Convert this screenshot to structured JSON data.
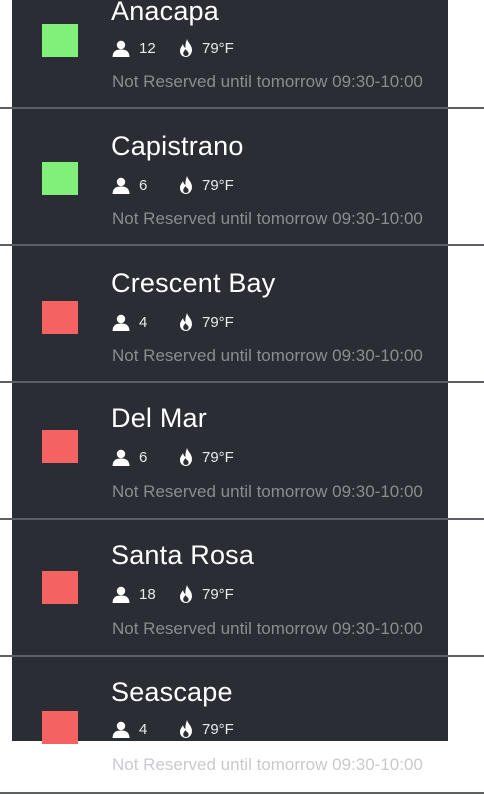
{
  "colors": {
    "panel_bg": "#2a2d34",
    "available": "#80f07a",
    "occupied": "#f46361",
    "divider": "#5c5f66"
  },
  "icons": {
    "capacity": "person-icon",
    "temperature": "flame-icon"
  },
  "rooms": [
    {
      "name": "Anacapa",
      "status": "available",
      "capacity": "12",
      "temperature": "79°F",
      "reservation": "Not Reserved until tomorrow 09:30-10:00"
    },
    {
      "name": "Capistrano",
      "status": "available",
      "capacity": "6",
      "temperature": "79°F",
      "reservation": "Not Reserved until tomorrow 09:30-10:00"
    },
    {
      "name": "Crescent Bay",
      "status": "occupied",
      "capacity": "4",
      "temperature": "79°F",
      "reservation": "Not Reserved until tomorrow 09:30-10:00"
    },
    {
      "name": "Del Mar",
      "status": "occupied",
      "capacity": "6",
      "temperature": "79°F",
      "reservation": "Not Reserved until tomorrow 09:30-10:00"
    },
    {
      "name": "Santa Rosa",
      "status": "occupied",
      "capacity": "18",
      "temperature": "79°F",
      "reservation": "Not Reserved until tomorrow 09:30-10:00"
    },
    {
      "name": "Seascape",
      "status": "occupied",
      "capacity": "4",
      "temperature": "79°F",
      "reservation": "Not Reserved until tomorrow 09:30-10:00"
    }
  ]
}
